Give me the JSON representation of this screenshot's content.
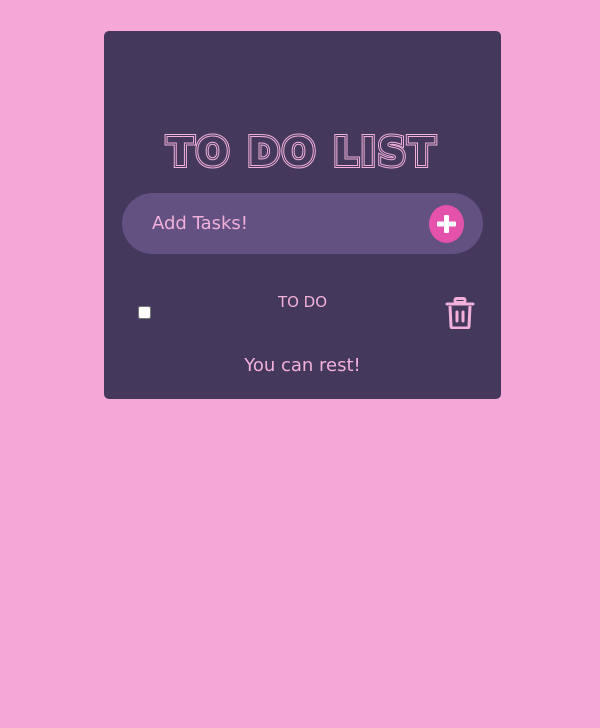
{
  "app": {
    "title": "TO DO LIST",
    "colors": {
      "page_background": "#f5a8d8",
      "card_background": "#44385c",
      "input_background": "#625181",
      "accent": "#e552ac",
      "text": "#f2b0db"
    }
  },
  "input": {
    "placeholder": "Add Tasks!",
    "value": "",
    "add_icon": "plus-icon"
  },
  "todos": [
    {
      "text": "TO DO",
      "checked": false,
      "delete_icon": "trash-icon"
    }
  ],
  "footer": {
    "message": "You can rest!"
  }
}
